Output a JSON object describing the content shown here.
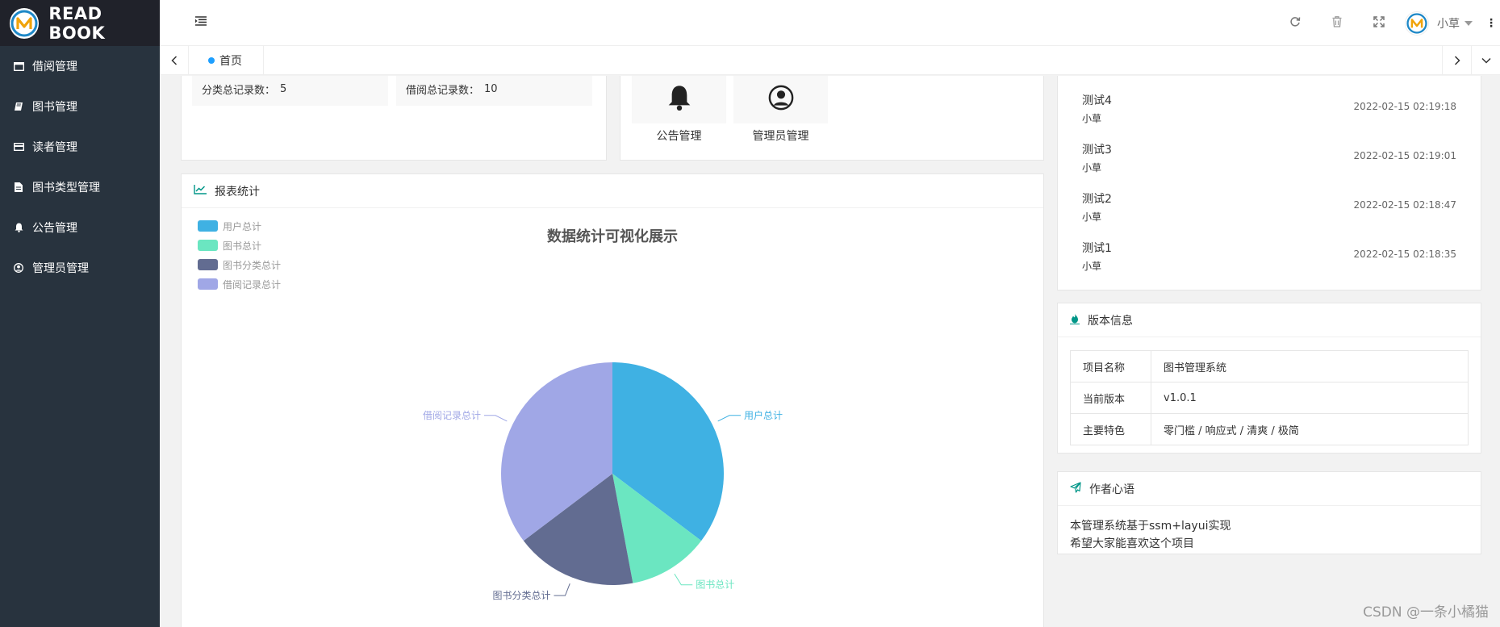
{
  "app": {
    "title": "READ BOOK"
  },
  "sidebar": {
    "items": [
      {
        "label": "借阅管理",
        "icon": "borrow-window-icon"
      },
      {
        "label": "图书管理",
        "icon": "book-icon"
      },
      {
        "label": "读者管理",
        "icon": "reader-card-icon"
      },
      {
        "label": "图书类型管理",
        "icon": "document-icon"
      },
      {
        "label": "公告管理",
        "icon": "bell-icon"
      },
      {
        "label": "管理员管理",
        "icon": "user-circle-icon"
      }
    ]
  },
  "header": {
    "user_name": "小草"
  },
  "tabs": [
    {
      "label": "首页"
    }
  ],
  "stats": {
    "category": {
      "label": "分类总记录数：",
      "value": "5",
      "accent": "#ffb800"
    },
    "borrow": {
      "label": "借阅总记录数：",
      "value": "10",
      "accent": "#009688"
    }
  },
  "quick": [
    {
      "label": "公告管理",
      "icon": "bell-icon"
    },
    {
      "label": "管理员管理",
      "icon": "user-circle-icon"
    }
  ],
  "report": {
    "title": "报表统计",
    "chart_title": "数据统计可视化展示"
  },
  "chart_data": {
    "type": "pie",
    "title": "数据统计可视化展示",
    "legend_position": "top-left",
    "slices": [
      {
        "name": "用户总计",
        "value": 6,
        "color": "#3fb1e3"
      },
      {
        "name": "图书总计",
        "value": 2,
        "color": "#6be6c1"
      },
      {
        "name": "图书分类总计",
        "value": 5,
        "color": "#626c91"
      },
      {
        "name": "借阅记录总计",
        "value": 10,
        "color": "#a0a7e6"
      }
    ],
    "render_values": [
      6,
      2,
      3,
      6
    ]
  },
  "notices": [
    {
      "title": "测试4",
      "author": "小草",
      "time": "2022-02-15 02:19:18"
    },
    {
      "title": "测试3",
      "author": "小草",
      "time": "2022-02-15 02:19:01"
    },
    {
      "title": "测试2",
      "author": "小草",
      "time": "2022-02-15 02:18:47"
    },
    {
      "title": "测试1",
      "author": "小草",
      "time": "2022-02-15 02:18:35"
    }
  ],
  "version": {
    "title": "版本信息",
    "rows": [
      {
        "key": "项目名称",
        "value": "图书管理系统"
      },
      {
        "key": "当前版本",
        "value": "v1.0.1"
      },
      {
        "key": "主要特色",
        "value": "零门槛 / 响应式 / 清爽 / 极简"
      }
    ]
  },
  "author": {
    "title": "作者心语",
    "lines": [
      "本管理系统基于ssm+layui实现",
      "希望大家能喜欢这个项目"
    ]
  },
  "watermark": "CSDN @一条小橘猫"
}
